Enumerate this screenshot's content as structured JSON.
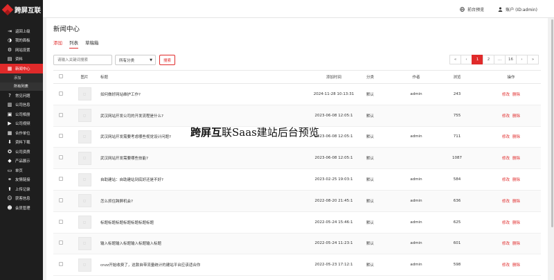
{
  "brand": {
    "name": "跨屏互联"
  },
  "sidebar": {
    "items": [
      {
        "label": "返回上级",
        "icon": "exit-icon"
      },
      {
        "label": "我的面板",
        "icon": "palette-icon"
      },
      {
        "label": "网站设置",
        "icon": "gear-icon"
      },
      {
        "label": "资料",
        "icon": "id-card-icon"
      },
      {
        "label": "新闻中心",
        "icon": "newspaper-icon",
        "active": true
      },
      {
        "label": "常见问题",
        "icon": "question-icon"
      },
      {
        "label": "公司信息",
        "icon": "document-icon"
      },
      {
        "label": "公司相册",
        "icon": "image-icon"
      },
      {
        "label": "公司视频",
        "icon": "video-icon"
      },
      {
        "label": "合作单位",
        "icon": "calendar-icon"
      },
      {
        "label": "资料下载",
        "icon": "download-icon"
      },
      {
        "label": "公司资质",
        "icon": "medal-icon"
      },
      {
        "label": "产品展示",
        "icon": "gift-icon"
      },
      {
        "label": "单页",
        "icon": "page-icon"
      },
      {
        "label": "友情链接",
        "icon": "link-icon"
      },
      {
        "label": "上传记录",
        "icon": "upload-icon"
      },
      {
        "label": "获客信息",
        "icon": "users-icon"
      },
      {
        "label": "会员管理",
        "icon": "member-icon"
      }
    ],
    "sub_items": [
      {
        "label": "添加"
      },
      {
        "label": "所有列表",
        "active": true
      }
    ]
  },
  "topbar": {
    "preview_label": "前台预览",
    "account_label": "账户 (ID:admin)"
  },
  "page": {
    "title": "新闻中心",
    "tabs": [
      {
        "label": "添加"
      },
      {
        "label": "列表"
      },
      {
        "label": "草稿箱"
      }
    ]
  },
  "filters": {
    "search_placeholder": "请输入关键词搜索",
    "category_selected": "所有分类",
    "search_button": "搜索"
  },
  "pagination": {
    "first": "«",
    "prev": "‹",
    "pages": [
      "1",
      "2",
      "...",
      "16"
    ],
    "current": "1",
    "next": "›",
    "last": "»"
  },
  "table": {
    "columns": [
      "图片",
      "标题",
      "添加时间",
      "分类",
      "作者",
      "浏览",
      "操作"
    ],
    "edit_label": "修改",
    "delete_label": "删除",
    "rows": [
      {
        "title": "如何做好网站维护工作?",
        "time": "2024-11-28 10:13:31",
        "category": "默认",
        "author": "admin",
        "views": "243"
      },
      {
        "title": "武汉网站开发公司的开发流程是什么?",
        "time": "2023-06-08 12:05:1",
        "category": "默认",
        "author": "",
        "views": "755"
      },
      {
        "title": "武汉网站开发需要考虑哪些视觉设计问题?",
        "time": "2023-06-08 12:05:1",
        "category": "默认",
        "author": "admin",
        "views": "711"
      },
      {
        "title": "武汉网站开发需要哪些技能?",
        "time": "2023-06-08 12:05:1",
        "category": "默认",
        "author": "",
        "views": "1087"
      },
      {
        "title": "自助建站：自助建站到底好还是不好?",
        "time": "2023-02-25 19:03:1",
        "category": "默认",
        "author": "admin",
        "views": "584"
      },
      {
        "title": "怎么抓住跨屏机会?",
        "time": "2022-08-20 21:45:1",
        "category": "默认",
        "author": "admin",
        "views": "636"
      },
      {
        "title": "标题标题标题标题标题标题标题",
        "time": "2022-05-24 15:46:1",
        "category": "默认",
        "author": "admin",
        "views": "625"
      },
      {
        "title": "输入标题输入标题输入标题输入标题",
        "time": "2022-05-24 11:23:1",
        "category": "默认",
        "author": "admin",
        "views": "601"
      },
      {
        "title": "cnzz开始收费了，这款自带流量统计的建站平台应该适合你",
        "time": "2022-05-23 17:12:1",
        "category": "默认",
        "author": "admin",
        "views": "598"
      }
    ]
  },
  "watermark": {
    "brand": "跨屏互",
    "rest": "联Saas建站后台预览"
  },
  "colors": {
    "accent": "#e02a2a",
    "sidebar_bg": "#1e1e1e"
  }
}
